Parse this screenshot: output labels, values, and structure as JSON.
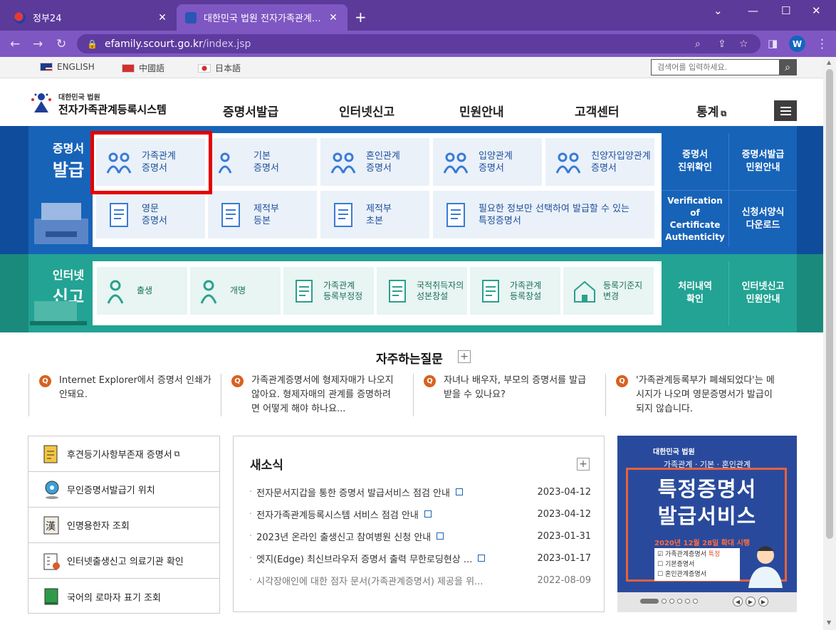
{
  "browser": {
    "tabs": [
      {
        "title": "정부24",
        "active": false
      },
      {
        "title": "대한민국 법원 전자가족관계등록",
        "active": true
      }
    ],
    "new_tab": "+",
    "url_host": "efamily.scourt.go.kr",
    "url_path": "/index.jsp",
    "profile_initial": "W",
    "accent": "#7e57c2"
  },
  "langbar": {
    "languages": [
      "ENGLISH",
      "中國語",
      "日本語"
    ],
    "search_placeholder": "검색어를 입력하세요."
  },
  "header": {
    "logo_small": "대한민국 법원",
    "logo_big": "전자가족관계등록시스템",
    "menu": [
      "증명서발급",
      "인터넷신고",
      "민원안내",
      "고객센터",
      "통계"
    ]
  },
  "certificates": {
    "title_top": "증명서",
    "title_bottom": "발급",
    "row1": [
      "가족관계\n증명서",
      "기본\n증명서",
      "혼인관계\n증명서",
      "입양관계\n증명서",
      "친양자입양관계\n증명서"
    ],
    "row2": [
      "영문\n증명서",
      "제적부\n등본",
      "제적부\n초본",
      "필요한 정보만 선택하여 발급할 수 있는\n특정증명서"
    ],
    "side": [
      "증명서\n진위확인",
      "증명서발급\n민원안내",
      "Verification of\nCertificate\nAuthenticity",
      "신청서양식\n다운로드"
    ],
    "highlighted": "가족관계\n증명서"
  },
  "internet_report": {
    "title_top": "인터넷",
    "title_bottom": "신고",
    "items": [
      "출생",
      "개명",
      "가족관계\n등록부정정",
      "국적취득자의\n성본창설",
      "가족관계\n등록창설",
      "등록기준지\n변경"
    ],
    "side": [
      "처리내역\n확인",
      "인터넷신고\n민원안내"
    ]
  },
  "faq": {
    "title": "자주하는질문",
    "badge": "Q",
    "items": [
      [
        "Internet Explorer에서 증명서 인쇄가",
        "안돼요."
      ],
      [
        "가족관계증명서에 형제자매가 나오지",
        "않아요. 형제자매의 관계를 증명하려",
        "면 어떻게 해야 하나요..."
      ],
      [
        "자녀나 배우자, 부모의 증명서를 발급",
        "받을 수 있나요?"
      ],
      [
        "'가족관계등록부가 폐쇄되었다'는 메",
        "시지가 나오며 영문증명서가 발급이",
        "되지 않습니다."
      ]
    ]
  },
  "quick_links": [
    "후견등기사항부존재 증명서",
    "무인증명서발급기 위치",
    "인명용한자 조회",
    "인터넷출생신고 의료기관 확인",
    "국어의 로마자 표기 조회"
  ],
  "news": {
    "title": "새소식",
    "items": [
      {
        "text": "전자문서지갑을 통한 증명서 발급서비스 점검 안내",
        "date": "2023-04-12"
      },
      {
        "text": "전자가족관계등록시스템 서비스 점검 안내",
        "date": "2023-04-12"
      },
      {
        "text": "2023년 온라인 출생신고 참여병원 신청 안내",
        "date": "2023-01-31"
      },
      {
        "text": "엣지(Edge) 최신브라우저 증명서 출력 무한로딩현상 ...",
        "date": "2023-01-17"
      },
      {
        "text": "시각장애인에 대한 점자 문서(가족관계증명서) 제공을 위...",
        "date": "2022-08-09"
      }
    ]
  },
  "banner": {
    "brand": "대한민국 법원",
    "subtitle": "가족관계 · 기본 · 혼인관계",
    "line1": "특정증명서",
    "line2": "발급서비스",
    "date": "2020년 12월 28일 확대 시행",
    "options": [
      "가족관계증명서",
      "기본증명서",
      "혼인관계증명서"
    ],
    "tag": "특정"
  }
}
